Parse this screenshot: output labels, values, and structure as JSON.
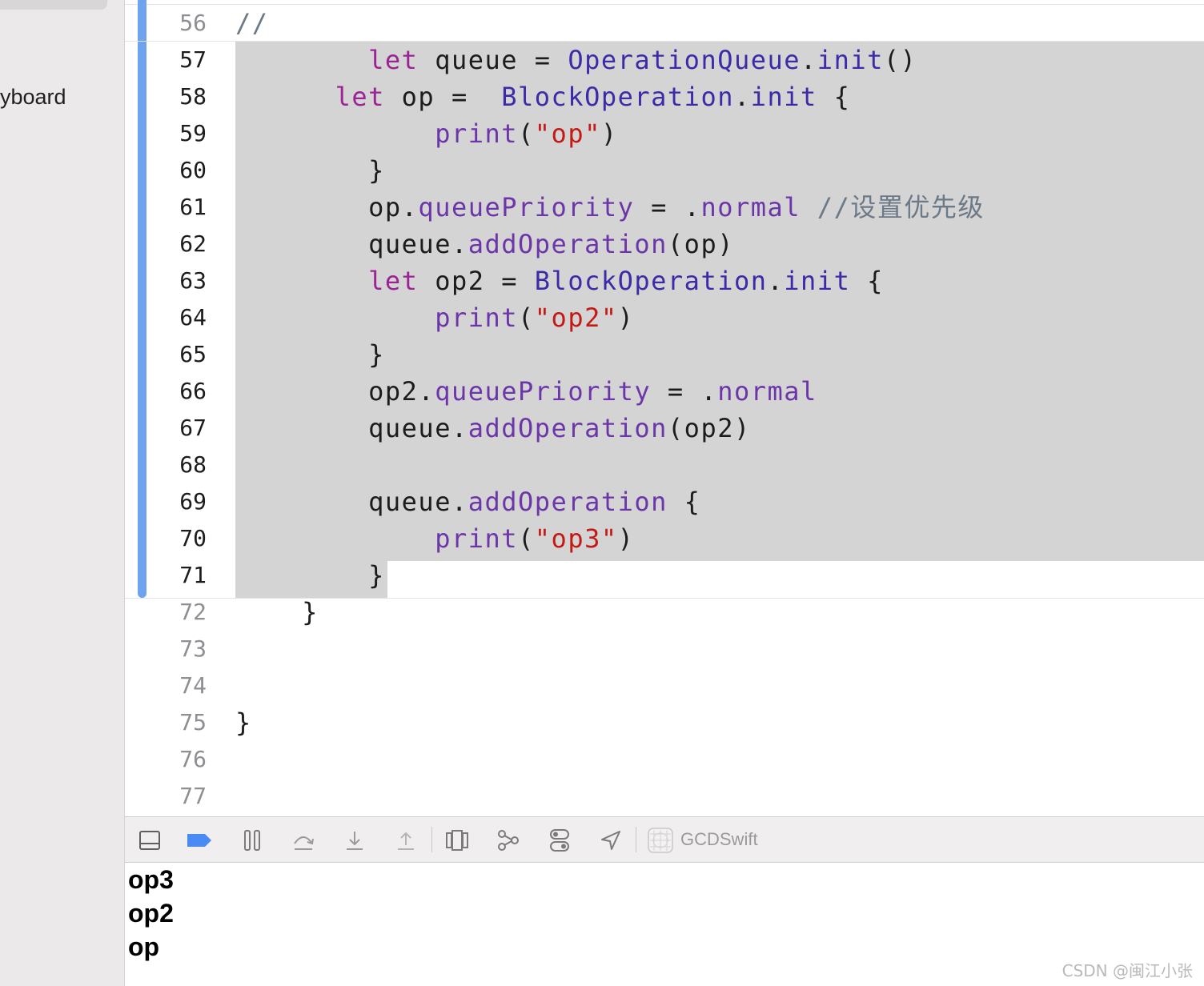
{
  "sidebar": {
    "partial_label": "yboard"
  },
  "editor": {
    "lines": [
      {
        "num": "56",
        "tokens": [
          {
            "t": "//",
            "c": "cm"
          }
        ]
      },
      {
        "num": "57",
        "tokens": [
          {
            "t": "        "
          },
          {
            "t": "let",
            "c": "kw"
          },
          {
            "t": " queue = "
          },
          {
            "t": "OperationQueue",
            "c": "ty"
          },
          {
            "t": "."
          },
          {
            "t": "init",
            "c": "ty"
          },
          {
            "t": "()"
          }
        ]
      },
      {
        "num": "58",
        "tokens": [
          {
            "t": "      "
          },
          {
            "t": "let",
            "c": "kw"
          },
          {
            "t": " op =  "
          },
          {
            "t": "BlockOperation",
            "c": "ty"
          },
          {
            "t": "."
          },
          {
            "t": "init",
            "c": "ty"
          },
          {
            "t": " {"
          }
        ]
      },
      {
        "num": "59",
        "tokens": [
          {
            "t": "            "
          },
          {
            "t": "print",
            "c": "fn"
          },
          {
            "t": "("
          },
          {
            "t": "\"op\"",
            "c": "st"
          },
          {
            "t": ")"
          }
        ]
      },
      {
        "num": "60",
        "tokens": [
          {
            "t": "        }"
          }
        ]
      },
      {
        "num": "61",
        "tokens": [
          {
            "t": "        op."
          },
          {
            "t": "queuePriority",
            "c": "fn"
          },
          {
            "t": " = ."
          },
          {
            "t": "normal",
            "c": "fn"
          },
          {
            "t": " "
          },
          {
            "t": "//设置优先级",
            "c": "cm"
          }
        ]
      },
      {
        "num": "62",
        "tokens": [
          {
            "t": "        queue."
          },
          {
            "t": "addOperation",
            "c": "fn"
          },
          {
            "t": "(op)"
          }
        ]
      },
      {
        "num": "63",
        "tokens": [
          {
            "t": "        "
          },
          {
            "t": "let",
            "c": "kw"
          },
          {
            "t": " op2 = "
          },
          {
            "t": "BlockOperation",
            "c": "ty"
          },
          {
            "t": "."
          },
          {
            "t": "init",
            "c": "ty"
          },
          {
            "t": " {"
          }
        ]
      },
      {
        "num": "64",
        "tokens": [
          {
            "t": "            "
          },
          {
            "t": "print",
            "c": "fn"
          },
          {
            "t": "("
          },
          {
            "t": "\"op2\"",
            "c": "st"
          },
          {
            "t": ")"
          }
        ]
      },
      {
        "num": "65",
        "tokens": [
          {
            "t": "        }"
          }
        ]
      },
      {
        "num": "66",
        "tokens": [
          {
            "t": "        op2."
          },
          {
            "t": "queuePriority",
            "c": "fn"
          },
          {
            "t": " = ."
          },
          {
            "t": "normal",
            "c": "fn"
          }
        ]
      },
      {
        "num": "67",
        "tokens": [
          {
            "t": "        queue."
          },
          {
            "t": "addOperation",
            "c": "fn"
          },
          {
            "t": "(op2)"
          }
        ]
      },
      {
        "num": "68",
        "tokens": []
      },
      {
        "num": "69",
        "tokens": [
          {
            "t": "        queue."
          },
          {
            "t": "addOperation",
            "c": "fn"
          },
          {
            "t": " {"
          }
        ]
      },
      {
        "num": "70",
        "tokens": [
          {
            "t": "            "
          },
          {
            "t": "print",
            "c": "fn"
          },
          {
            "t": "("
          },
          {
            "t": "\"op3\"",
            "c": "st"
          },
          {
            "t": ")"
          }
        ]
      },
      {
        "num": "71",
        "tokens": [
          {
            "t": "        }"
          }
        ]
      },
      {
        "num": "72",
        "tokens": [
          {
            "t": "    }"
          }
        ]
      },
      {
        "num": "73",
        "tokens": []
      },
      {
        "num": "74",
        "tokens": []
      },
      {
        "num": "75",
        "tokens": [
          {
            "t": "}"
          }
        ]
      },
      {
        "num": "76",
        "tokens": []
      },
      {
        "num": "77",
        "tokens": []
      }
    ],
    "selected_lines": [
      "57",
      "58",
      "59",
      "60",
      "61",
      "62",
      "63",
      "64",
      "65",
      "66",
      "67",
      "68",
      "69",
      "70",
      "71"
    ]
  },
  "debug_bar": {
    "buttons": [
      {
        "name": "hide-debug-area",
        "icon": "panel-bottom-icon"
      },
      {
        "name": "breakpoints-toggle",
        "icon": "breakpoint-icon"
      },
      {
        "name": "pause-button",
        "icon": "pause-icon"
      },
      {
        "name": "step-over-button",
        "icon": "step-over-icon"
      },
      {
        "name": "step-into-button",
        "icon": "step-into-icon"
      },
      {
        "name": "step-out-button",
        "icon": "step-out-icon"
      },
      {
        "name": "view-hierarchy-button",
        "icon": "view-debugger-icon"
      },
      {
        "name": "memory-graph-button",
        "icon": "memory-graph-icon"
      },
      {
        "name": "environment-overrides-button",
        "icon": "toggles-icon"
      },
      {
        "name": "simulate-location-button",
        "icon": "location-arrow-icon"
      }
    ],
    "scheme": "GCDSwift",
    "accent": "#4a8af4"
  },
  "console": {
    "lines": [
      "op3",
      "op2",
      "op"
    ]
  },
  "watermark": "CSDN @闽江小张"
}
